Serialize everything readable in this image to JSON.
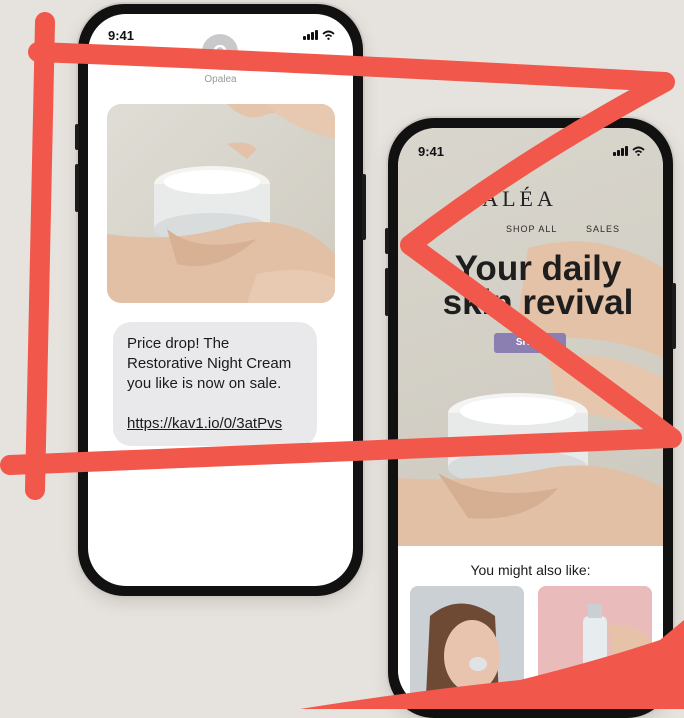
{
  "colors": {
    "background": "#e6e2dd",
    "scribble": "#f1574a",
    "cta": "#8b7fb1"
  },
  "phone_sms": {
    "time": "9:41",
    "contact_initial": "O",
    "contact_name": "Opalea",
    "message": {
      "text": "Price drop! The Restorative Night Cream you like is now on sale.",
      "link": "https://kav1.io/0/3atPvs"
    }
  },
  "phone_site": {
    "time": "9:41",
    "brand": "PALÉA",
    "nav": [
      "SHOP ALL",
      "SALES"
    ],
    "hero_title_line1": "Your daily",
    "hero_title_line2": "skin revival",
    "cta_label": "SHOP",
    "recommendations_title": "You might also like:"
  }
}
